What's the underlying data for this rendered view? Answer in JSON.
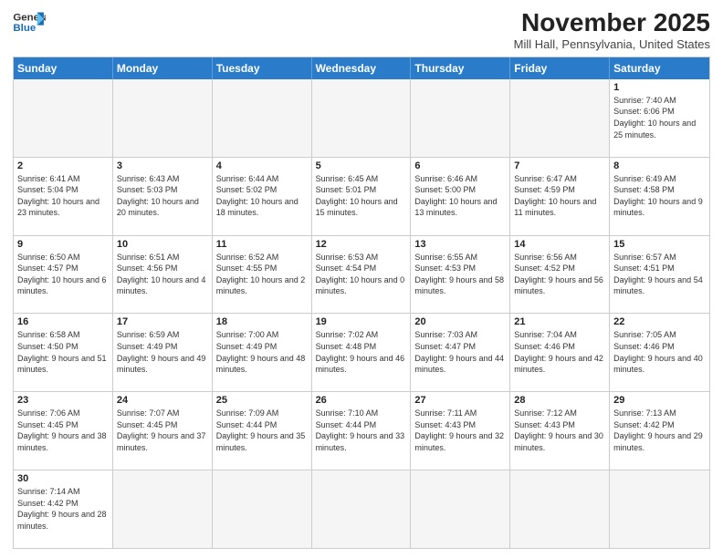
{
  "header": {
    "logo_line1": "General",
    "logo_line2": "Blue",
    "month_title": "November 2025",
    "location": "Mill Hall, Pennsylvania, United States"
  },
  "days_of_week": [
    "Sunday",
    "Monday",
    "Tuesday",
    "Wednesday",
    "Thursday",
    "Friday",
    "Saturday"
  ],
  "weeks": [
    [
      {
        "day": "",
        "empty": true
      },
      {
        "day": "",
        "empty": true
      },
      {
        "day": "",
        "empty": true
      },
      {
        "day": "",
        "empty": true
      },
      {
        "day": "",
        "empty": true
      },
      {
        "day": "",
        "empty": true
      },
      {
        "day": "1",
        "sunrise": "7:40 AM",
        "sunset": "6:06 PM",
        "daylight": "10 hours and 25 minutes."
      }
    ],
    [
      {
        "day": "2",
        "sunrise": "6:41 AM",
        "sunset": "5:04 PM",
        "daylight": "10 hours and 23 minutes."
      },
      {
        "day": "3",
        "sunrise": "6:43 AM",
        "sunset": "5:03 PM",
        "daylight": "10 hours and 20 minutes."
      },
      {
        "day": "4",
        "sunrise": "6:44 AM",
        "sunset": "5:02 PM",
        "daylight": "10 hours and 18 minutes."
      },
      {
        "day": "5",
        "sunrise": "6:45 AM",
        "sunset": "5:01 PM",
        "daylight": "10 hours and 15 minutes."
      },
      {
        "day": "6",
        "sunrise": "6:46 AM",
        "sunset": "5:00 PM",
        "daylight": "10 hours and 13 minutes."
      },
      {
        "day": "7",
        "sunrise": "6:47 AM",
        "sunset": "4:59 PM",
        "daylight": "10 hours and 11 minutes."
      },
      {
        "day": "8",
        "sunrise": "6:49 AM",
        "sunset": "4:58 PM",
        "daylight": "10 hours and 9 minutes."
      }
    ],
    [
      {
        "day": "9",
        "sunrise": "6:50 AM",
        "sunset": "4:57 PM",
        "daylight": "10 hours and 6 minutes."
      },
      {
        "day": "10",
        "sunrise": "6:51 AM",
        "sunset": "4:56 PM",
        "daylight": "10 hours and 4 minutes."
      },
      {
        "day": "11",
        "sunrise": "6:52 AM",
        "sunset": "4:55 PM",
        "daylight": "10 hours and 2 minutes."
      },
      {
        "day": "12",
        "sunrise": "6:53 AM",
        "sunset": "4:54 PM",
        "daylight": "10 hours and 0 minutes."
      },
      {
        "day": "13",
        "sunrise": "6:55 AM",
        "sunset": "4:53 PM",
        "daylight": "9 hours and 58 minutes."
      },
      {
        "day": "14",
        "sunrise": "6:56 AM",
        "sunset": "4:52 PM",
        "daylight": "9 hours and 56 minutes."
      },
      {
        "day": "15",
        "sunrise": "6:57 AM",
        "sunset": "4:51 PM",
        "daylight": "9 hours and 54 minutes."
      }
    ],
    [
      {
        "day": "16",
        "sunrise": "6:58 AM",
        "sunset": "4:50 PM",
        "daylight": "9 hours and 51 minutes."
      },
      {
        "day": "17",
        "sunrise": "6:59 AM",
        "sunset": "4:49 PM",
        "daylight": "9 hours and 49 minutes."
      },
      {
        "day": "18",
        "sunrise": "7:00 AM",
        "sunset": "4:49 PM",
        "daylight": "9 hours and 48 minutes."
      },
      {
        "day": "19",
        "sunrise": "7:02 AM",
        "sunset": "4:48 PM",
        "daylight": "9 hours and 46 minutes."
      },
      {
        "day": "20",
        "sunrise": "7:03 AM",
        "sunset": "4:47 PM",
        "daylight": "9 hours and 44 minutes."
      },
      {
        "day": "21",
        "sunrise": "7:04 AM",
        "sunset": "4:46 PM",
        "daylight": "9 hours and 42 minutes."
      },
      {
        "day": "22",
        "sunrise": "7:05 AM",
        "sunset": "4:46 PM",
        "daylight": "9 hours and 40 minutes."
      }
    ],
    [
      {
        "day": "23",
        "sunrise": "7:06 AM",
        "sunset": "4:45 PM",
        "daylight": "9 hours and 38 minutes."
      },
      {
        "day": "24",
        "sunrise": "7:07 AM",
        "sunset": "4:45 PM",
        "daylight": "9 hours and 37 minutes."
      },
      {
        "day": "25",
        "sunrise": "7:09 AM",
        "sunset": "4:44 PM",
        "daylight": "9 hours and 35 minutes."
      },
      {
        "day": "26",
        "sunrise": "7:10 AM",
        "sunset": "4:44 PM",
        "daylight": "9 hours and 33 minutes."
      },
      {
        "day": "27",
        "sunrise": "7:11 AM",
        "sunset": "4:43 PM",
        "daylight": "9 hours and 32 minutes."
      },
      {
        "day": "28",
        "sunrise": "7:12 AM",
        "sunset": "4:43 PM",
        "daylight": "9 hours and 30 minutes."
      },
      {
        "day": "29",
        "sunrise": "7:13 AM",
        "sunset": "4:42 PM",
        "daylight": "9 hours and 29 minutes."
      }
    ],
    [
      {
        "day": "30",
        "sunrise": "7:14 AM",
        "sunset": "4:42 PM",
        "daylight": "9 hours and 28 minutes."
      },
      {
        "day": "",
        "empty": true
      },
      {
        "day": "",
        "empty": true
      },
      {
        "day": "",
        "empty": true
      },
      {
        "day": "",
        "empty": true
      },
      {
        "day": "",
        "empty": true
      },
      {
        "day": "",
        "empty": true
      }
    ]
  ]
}
